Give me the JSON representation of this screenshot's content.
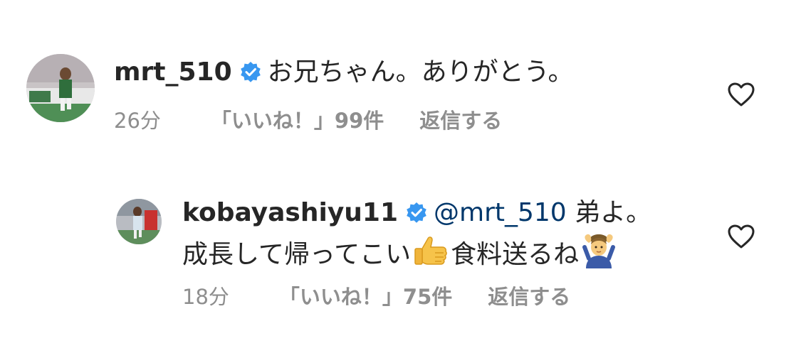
{
  "comments": [
    {
      "username": "mrt_510",
      "text": "お兄ちゃん。ありがとう。",
      "time": "26分",
      "likes": "「いいね！」99件",
      "reply": "返信する"
    },
    {
      "username": "kobayashiyu11",
      "mention": "@mrt_510",
      "text_line1": "弟よ。",
      "text_line2_a": "成長して帰ってこい",
      "text_line2_b": "食料送るね",
      "emojis": [
        "thumbs-up-icon",
        "person-gesturing-ok-icon"
      ],
      "time": "18分",
      "likes": "「いいね！」75件",
      "reply": "返信する"
    }
  ],
  "colors": {
    "text": "#262626",
    "muted": "#8e8e8e",
    "mention": "#00376b",
    "verified": "#3897f0"
  }
}
